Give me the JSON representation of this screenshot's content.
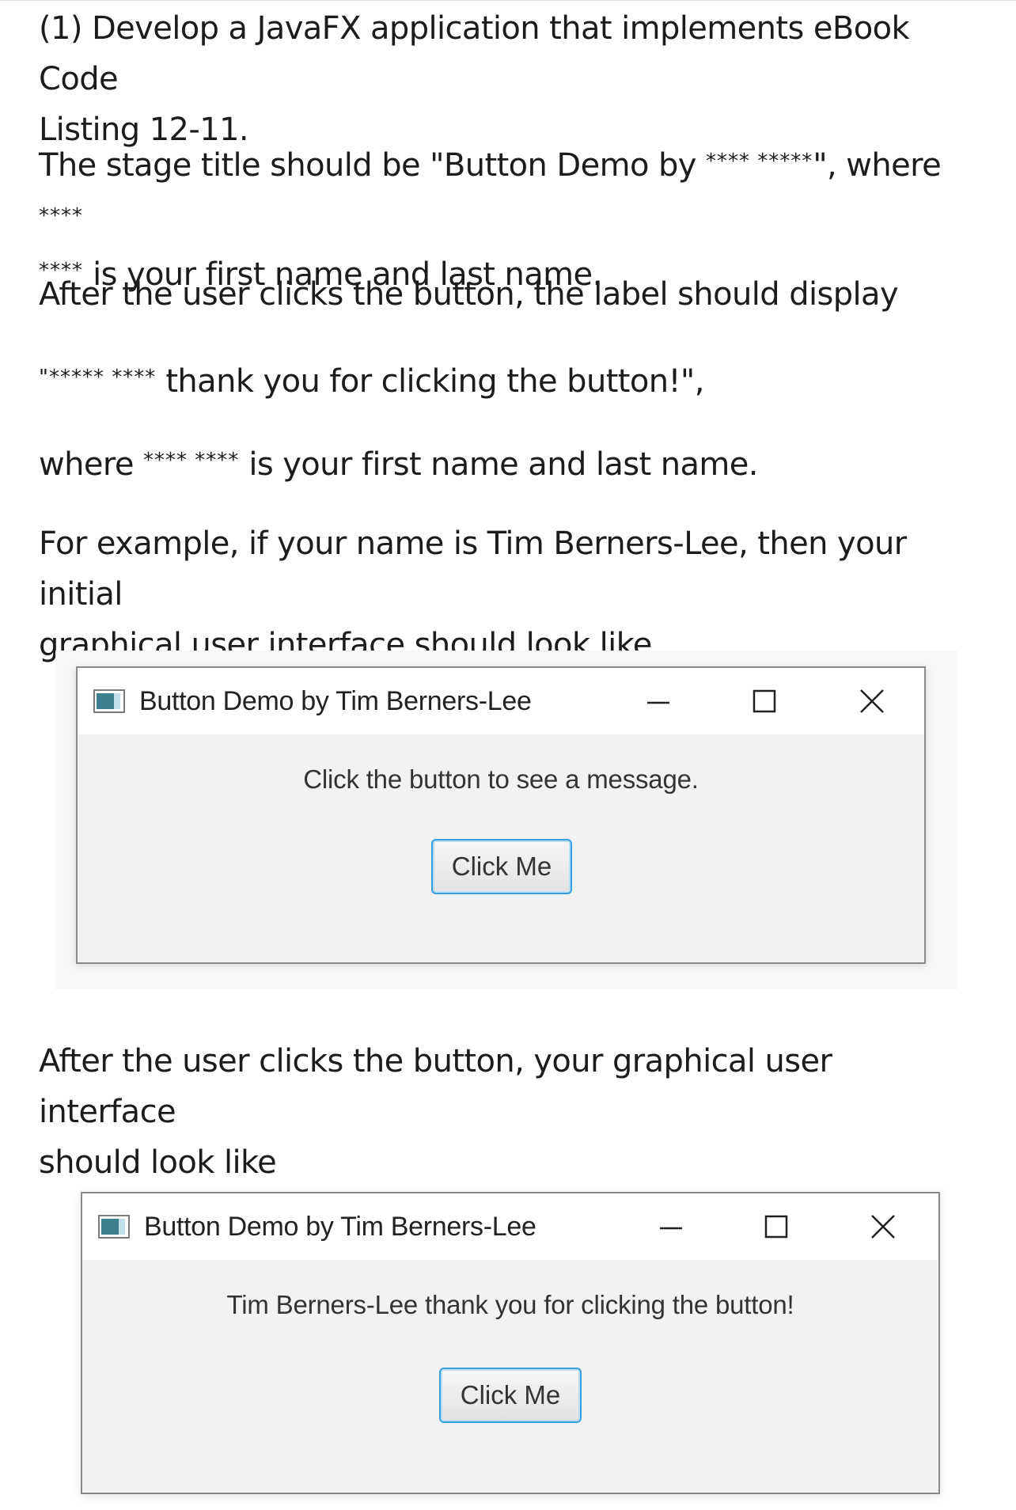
{
  "instructions": {
    "p1_line1": "(1) Develop a JavaFX application that implements eBook Code",
    "p1_line2": "Listing 12-11.",
    "p2_a": "The stage title should be \"Button Demo by ",
    "p2_stars1": "**** *****",
    "p2_b": "\", where ",
    "p2_stars2": "****",
    "p2_stars3": "****",
    "p2_c": " is your first name and last name.",
    "p3": "After the user clicks the button, the label should display",
    "p4_stars": "\"***** ****",
    "p4_text": " thank you for clicking the button!\",",
    "p5_a": "where ",
    "p5_stars": "**** ****",
    "p5_b": " is your first name and last name.",
    "p6_line1": "For example, if your name is Tim Berners-Lee, then your initial",
    "p6_line2": "graphical user interface should look like",
    "p7_line1": "After the user clicks the button, your graphical user interface",
    "p7_line2": "should look like"
  },
  "window_initial": {
    "title": "Button Demo by Tim Berners-Lee",
    "label": "Click the button to see a message.",
    "button": "Click Me"
  },
  "window_after": {
    "title": "Button Demo by Tim Berners-Lee",
    "label": "Tim Berners-Lee thank you for clicking the button!",
    "button": "Click Me"
  }
}
